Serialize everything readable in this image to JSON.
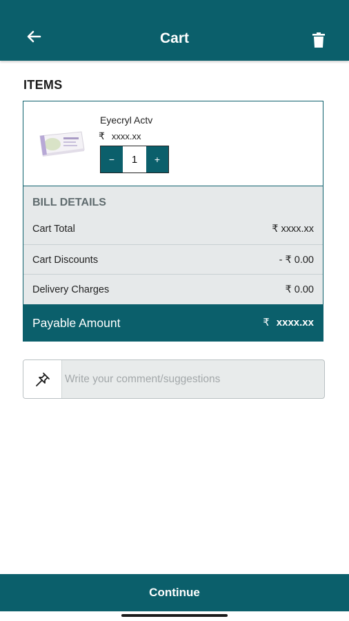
{
  "header": {
    "title": "Cart",
    "back_icon": "arrow-left-icon",
    "delete_icon": "trash-icon"
  },
  "items_section": {
    "title": "ITEMS"
  },
  "cart_item": {
    "name": "Eyecryl Actv",
    "currency": "₹",
    "price": "xxxx.xx",
    "quantity": "1",
    "decrement_label": "−",
    "increment_label": "+"
  },
  "bill": {
    "title": "BILL DETAILS",
    "rows": [
      {
        "label": "Cart Total",
        "value": "₹ xxxx.xx"
      },
      {
        "label": "Cart Discounts",
        "value": "- ₹ 0.00"
      },
      {
        "label": "Delivery Charges",
        "value": "₹ 0.00"
      }
    ],
    "payable_label": "Payable Amount",
    "payable_currency": "₹",
    "payable_value": "xxxx.xx"
  },
  "comment": {
    "placeholder": "Write your comment/suggestions",
    "icon": "pin-icon"
  },
  "footer": {
    "continue_label": "Continue"
  },
  "colors": {
    "primary": "#0b5f6b",
    "bill_bg": "#e6e9ea"
  }
}
